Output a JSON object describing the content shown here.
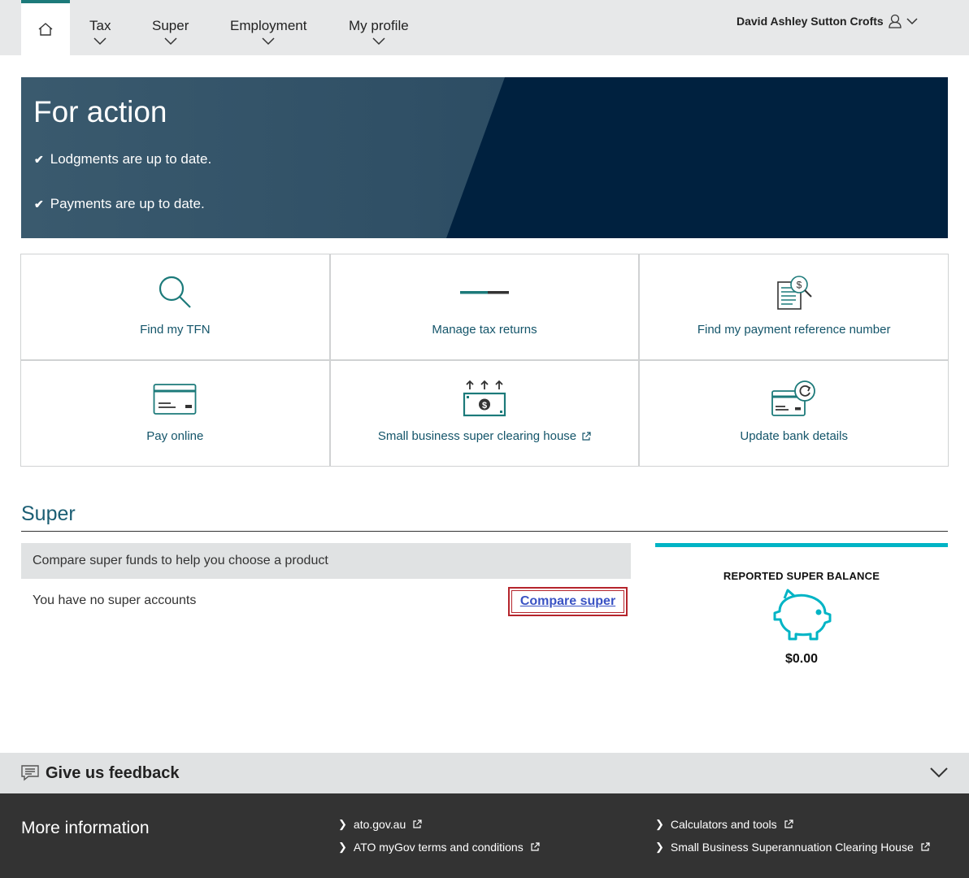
{
  "nav": {
    "items": [
      {
        "label": "Tax"
      },
      {
        "label": "Super"
      },
      {
        "label": "Employment"
      },
      {
        "label": "My profile"
      }
    ],
    "user_name": "David Ashley Sutton Crofts"
  },
  "hero": {
    "title": "For action",
    "lines": [
      "Lodgments are up to date.",
      "Payments are up to date."
    ]
  },
  "tiles": [
    {
      "label": "Find my TFN",
      "icon": "magnifier-icon"
    },
    {
      "label": "Manage tax returns",
      "icon": "progress-bar-icon"
    },
    {
      "label": "Find my payment reference number",
      "icon": "document-dollar-search-icon"
    },
    {
      "label": "Pay online",
      "icon": "credit-card-icon"
    },
    {
      "label": "Small business super clearing house",
      "icon": "dollar-bill-arrows-icon",
      "external": true
    },
    {
      "label": "Update bank details",
      "icon": "card-refresh-icon"
    }
  ],
  "super": {
    "heading": "Super",
    "compare_bar": "Compare super funds to help you choose a product",
    "no_accounts": "You have no super accounts",
    "compare_link": "Compare super",
    "balance_title": "REPORTED SUPER BALANCE",
    "balance_amount": "$0.00"
  },
  "feedback": {
    "label": "Give us feedback"
  },
  "footer": {
    "title": "More information",
    "links": [
      "ato.gov.au",
      "ATO myGov terms and conditions",
      "Calculators and tools",
      "Small Business Superannuation Clearing House"
    ]
  },
  "colors": {
    "teal": "#1c7a7a",
    "navy": "#00213f",
    "link_blue": "#3a53c4",
    "highlight_red": "#b5252c",
    "cyan_accent": "#00b4c5"
  }
}
